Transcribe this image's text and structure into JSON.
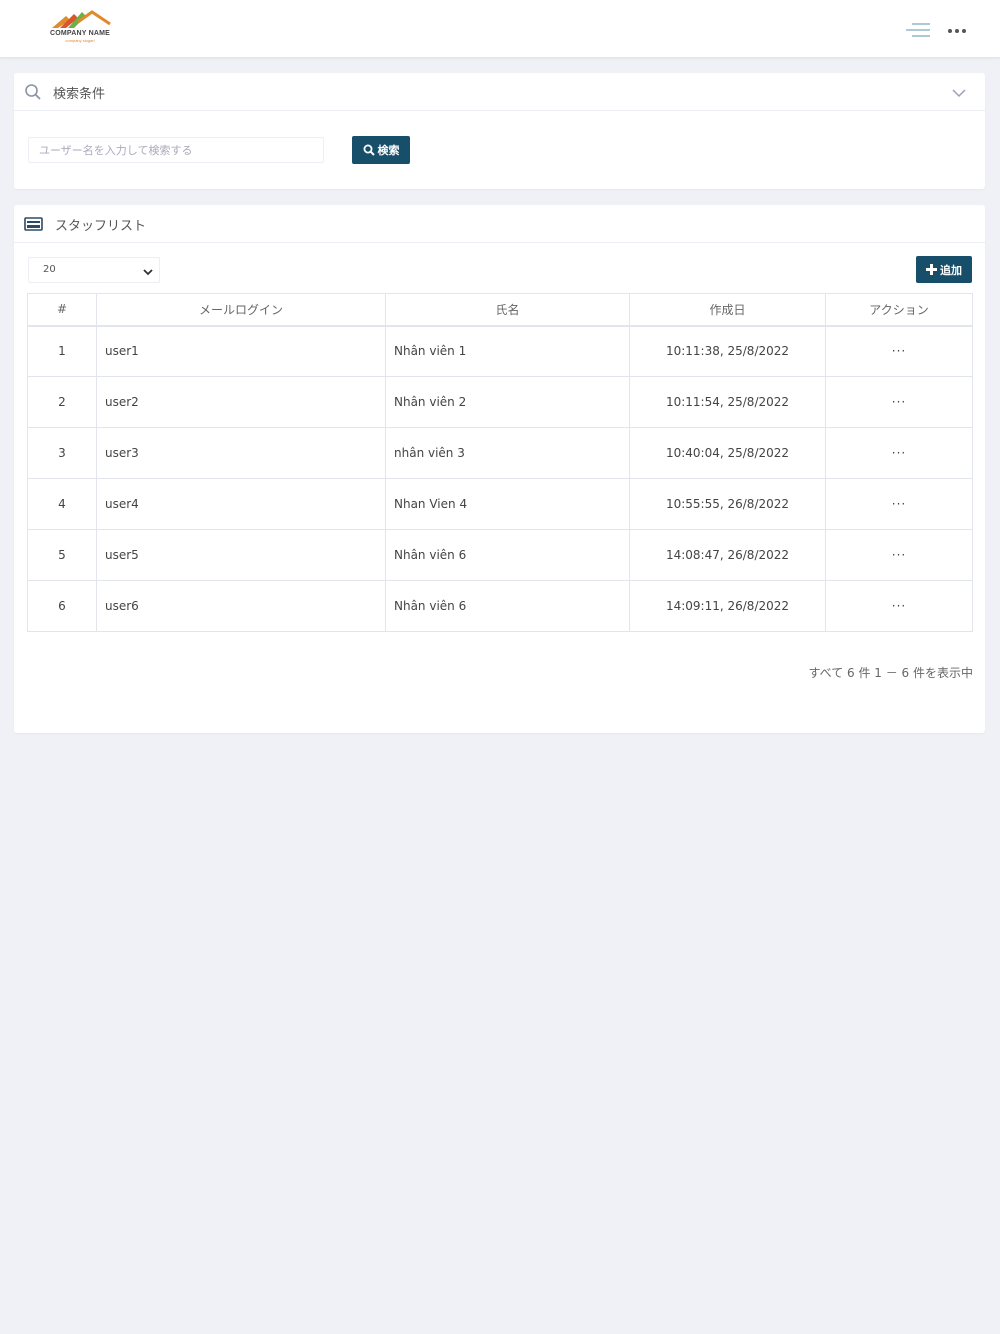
{
  "header": {
    "logo_text": "COMPANY NAME",
    "logo_tagline": "company slogan",
    "icons": [
      "hamburger-menu-icon",
      "more-horizontal-icon"
    ]
  },
  "search": {
    "title": "検索条件",
    "input_placeholder": "ユーザー名を入力して検索する",
    "input_value": "",
    "button_label": "検索",
    "icons": [
      "search-icon",
      "chevron-down-icon"
    ]
  },
  "staff_list": {
    "title": "スタッフリスト",
    "page_size": "20",
    "add_button_label": "追加",
    "columns": [
      "#",
      "メールログイン",
      "氏名",
      "作成日",
      "アクション"
    ],
    "rows": [
      {
        "num": "1",
        "email": "user1",
        "name": "Nhân viên 1",
        "created": "10:11:38, 25/8/2022",
        "action": "···"
      },
      {
        "num": "2",
        "email": "user2",
        "name": "Nhân viên 2",
        "created": "10:11:54, 25/8/2022",
        "action": "···"
      },
      {
        "num": "3",
        "email": "user3",
        "name": "nhân viên 3",
        "created": "10:40:04, 25/8/2022",
        "action": "···"
      },
      {
        "num": "4",
        "email": "user4",
        "name": "Nhan Vien 4",
        "created": "10:55:55, 26/8/2022",
        "action": "···"
      },
      {
        "num": "5",
        "email": "user5",
        "name": "Nhân viên 6",
        "created": "14:08:47, 26/8/2022",
        "action": "···"
      },
      {
        "num": "6",
        "email": "user6",
        "name": "Nhân viên 6",
        "created": "14:09:11, 26/8/2022",
        "action": "···"
      }
    ],
    "pagination_info": "すべて 6 件 1 － 6 件を表示中"
  },
  "colors": {
    "primary_button": "#174f6b",
    "background": "#f0f1f6",
    "logo_orange": "#e08a2a",
    "logo_green": "#6bb04a"
  }
}
